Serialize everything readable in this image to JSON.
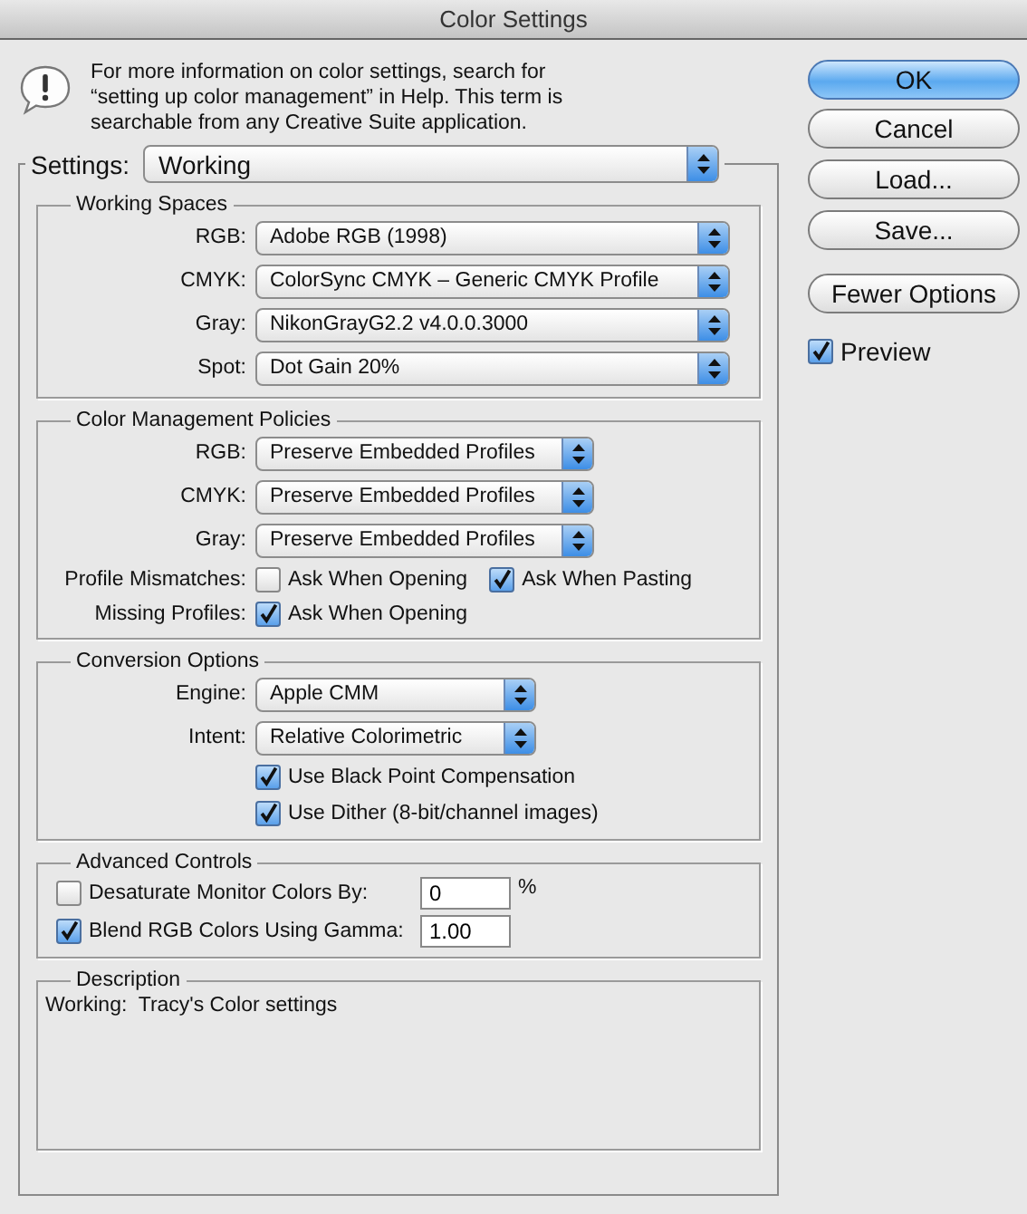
{
  "window": {
    "title": "Color Settings"
  },
  "info": {
    "lines": [
      "For more information on color settings, search for",
      "“setting up color management” in Help. This term is",
      "searchable from any Creative Suite application."
    ]
  },
  "settings": {
    "label": "Settings:",
    "value": "Working"
  },
  "sections": [
    {
      "kind": "spaces",
      "title": "Working Spaces",
      "rows": [
        {
          "kind": "select",
          "label": "RGB:",
          "value": "Adobe RGB (1998)"
        },
        {
          "kind": "select",
          "label": "CMYK:",
          "value": "ColorSync CMYK – Generic CMYK Profile"
        },
        {
          "kind": "select",
          "label": "Gray:",
          "value": "NikonGrayG2.2 v4.0.0.3000"
        },
        {
          "kind": "select",
          "label": "Spot:",
          "value": "Dot Gain 20%"
        }
      ]
    },
    {
      "kind": "policies",
      "title": "Color Management Policies",
      "rows": [
        {
          "kind": "select",
          "label": "RGB:",
          "value": "Preserve Embedded Profiles"
        },
        {
          "kind": "select",
          "label": "CMYK:",
          "value": "Preserve Embedded Profiles"
        },
        {
          "kind": "select",
          "label": "Gray:",
          "value": "Preserve Embedded Profiles"
        },
        {
          "kind": "checks",
          "label": "Profile Mismatches:",
          "checks": [
            {
              "label": "Ask When Opening",
              "checked": false
            },
            {
              "label": "Ask When Pasting",
              "checked": true
            }
          ]
        },
        {
          "kind": "checks",
          "label": "Missing Profiles:",
          "checks": [
            {
              "label": "Ask When Opening",
              "checked": true
            }
          ]
        }
      ]
    },
    {
      "kind": "conversion",
      "title": "Conversion Options",
      "rows": [
        {
          "kind": "select",
          "label": "Engine:",
          "value": "Apple CMM"
        },
        {
          "kind": "select",
          "label": "Intent:",
          "value": "Relative Colorimetric"
        },
        {
          "kind": "checks",
          "checks": [
            {
              "label": "Use Black Point Compensation",
              "checked": true
            }
          ]
        },
        {
          "kind": "checks",
          "checks": [
            {
              "label": "Use Dither (8-bit/channel images)",
              "checked": true
            }
          ]
        }
      ]
    },
    {
      "kind": "advanced",
      "title": "Advanced Controls",
      "rows": [
        {
          "kind": "field",
          "label": "Desaturate Monitor Colors By:",
          "checked": false,
          "value": "0",
          "unit": "%"
        },
        {
          "kind": "field",
          "label": "Blend RGB Colors Using Gamma:",
          "checked": true,
          "value": "1.00"
        }
      ]
    },
    {
      "kind": "description",
      "title": "Description",
      "text": "Working:  Tracy's Color settings"
    }
  ],
  "buttons": [
    {
      "label": "OK",
      "default": true
    },
    {
      "label": "Cancel",
      "default": false
    },
    {
      "label": "Load...",
      "default": false
    },
    {
      "label": "Save...",
      "default": false
    },
    {
      "label": "Fewer Options",
      "default": false
    }
  ],
  "preview": {
    "label": "Preview",
    "checked": true
  }
}
